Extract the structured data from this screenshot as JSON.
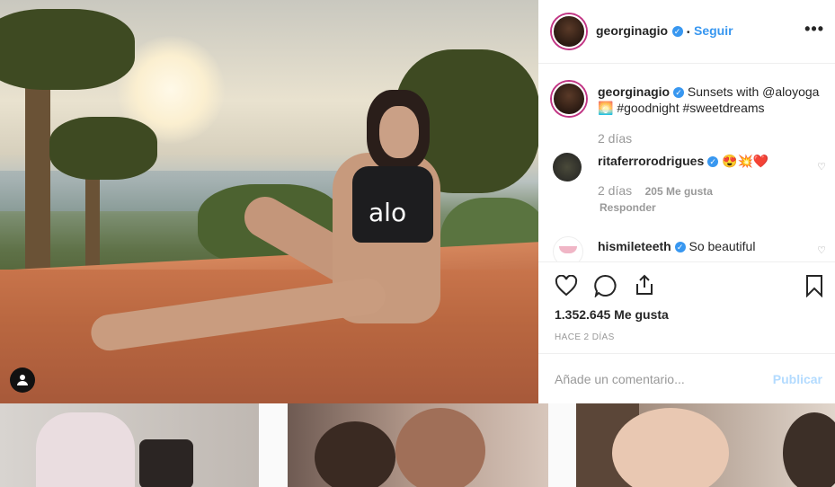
{
  "post": {
    "username": "georginagio",
    "follow_label": "Seguir",
    "separator": "•",
    "more_label": "•••",
    "caption_user": "georginagio",
    "caption_text": "Sunsets with @aloyoga 🌅 #goodnight #sweetdreams",
    "caption_time": "2 días",
    "top_logo": "alo",
    "likes": "1.352.645 Me gusta",
    "posted_ago": "HACE 2 DÍAS",
    "comment_placeholder": "Añade un comentario...",
    "publish_label": "Publicar"
  },
  "comments": [
    {
      "user": "ritaferrorodrigues",
      "text": "😍💥❤️",
      "time": "2 días",
      "likes": "205 Me gusta",
      "reply": "Responder"
    },
    {
      "user": "hismileteeth",
      "text": "So beautiful"
    }
  ],
  "colors": {
    "accent": "#3897f0",
    "publish_disabled": "#b3dbff"
  }
}
